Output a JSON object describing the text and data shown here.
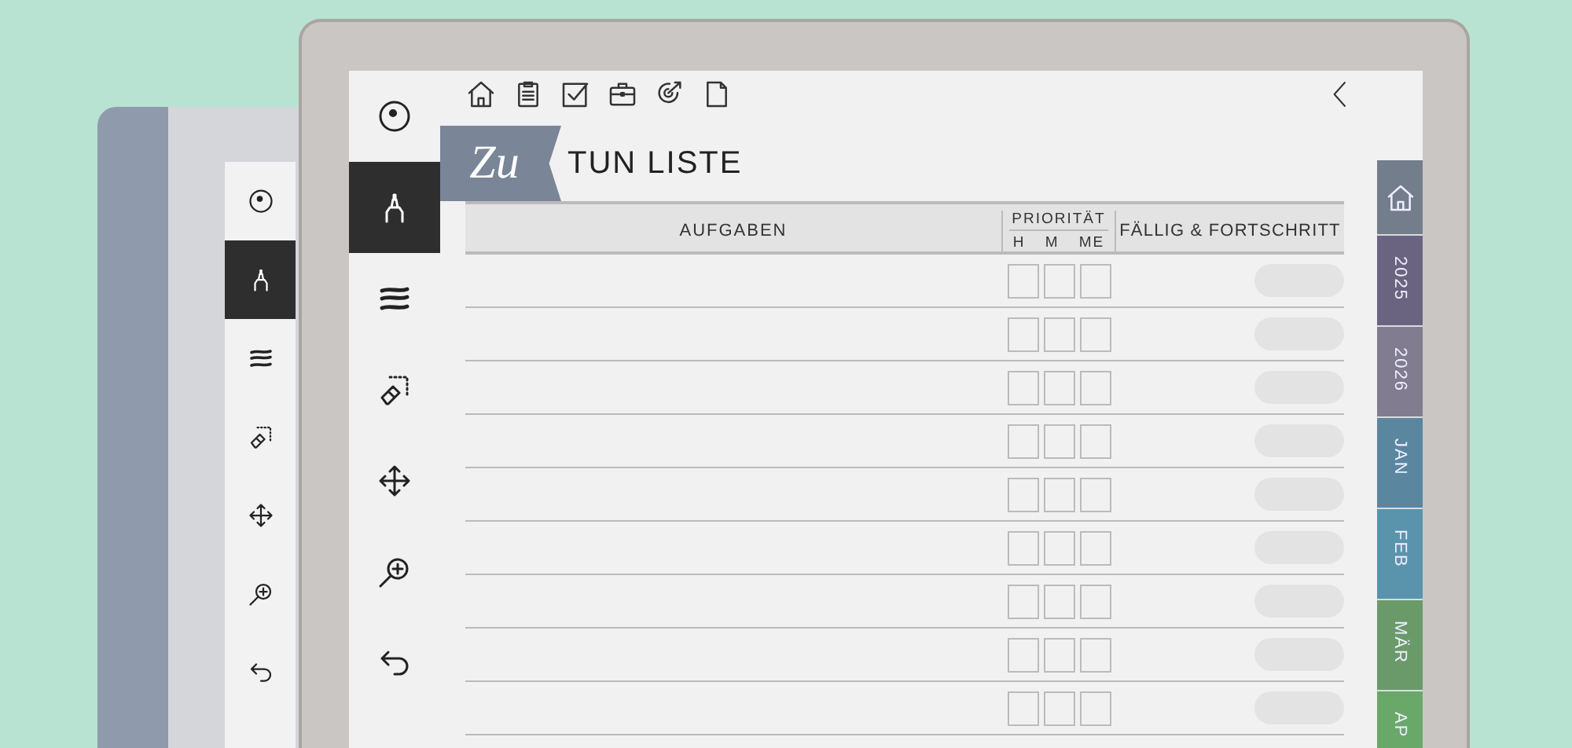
{
  "back_device": {
    "toolbar": [
      {
        "selected": false
      },
      {
        "selected": true
      },
      {
        "selected": false
      },
      {
        "selected": false
      },
      {
        "selected": false
      },
      {
        "selected": false
      },
      {
        "selected": false
      }
    ]
  },
  "front_device": {
    "toolbar": [
      {
        "selected": false
      },
      {
        "selected": true
      },
      {
        "selected": false
      },
      {
        "selected": false
      },
      {
        "selected": false
      },
      {
        "selected": false
      },
      {
        "selected": false
      }
    ],
    "title": {
      "script": "Zu",
      "text": "TUN LISTE"
    },
    "table": {
      "header": {
        "task": "AUFGABEN",
        "priority": {
          "label": "PRIORITÄT",
          "levels": [
            "H",
            "M",
            "ME"
          ]
        },
        "due": "FÄLLIG & FORTSCHRITT"
      },
      "rows": [
        {
          "priority": [
            {
              "checked": false
            },
            {
              "checked": false
            },
            {
              "checked": false
            }
          ]
        },
        {
          "priority": [
            {
              "checked": false
            },
            {
              "checked": false
            },
            {
              "checked": false
            }
          ]
        },
        {
          "priority": [
            {
              "checked": false
            },
            {
              "checked": false
            },
            {
              "checked": false
            }
          ]
        },
        {
          "priority": [
            {
              "checked": false
            },
            {
              "checked": false
            },
            {
              "checked": false
            }
          ]
        },
        {
          "priority": [
            {
              "checked": false
            },
            {
              "checked": false
            },
            {
              "checked": false
            }
          ]
        },
        {
          "priority": [
            {
              "checked": false
            },
            {
              "checked": false
            },
            {
              "checked": false
            }
          ]
        },
        {
          "priority": [
            {
              "checked": false
            },
            {
              "checked": false
            },
            {
              "checked": false
            }
          ]
        },
        {
          "priority": [
            {
              "checked": false
            },
            {
              "checked": false
            },
            {
              "checked": false
            }
          ]
        },
        {
          "priority": [
            {
              "checked": false
            },
            {
              "checked": false
            },
            {
              "checked": false
            }
          ]
        }
      ]
    },
    "side_tabs": [
      {
        "kind": "home",
        "color": "#737d8c"
      },
      {
        "kind": "text",
        "label": "2025",
        "color": "#6b6480"
      },
      {
        "kind": "text",
        "label": "2026",
        "color": "#817c90"
      },
      {
        "kind": "text",
        "label": "JAN",
        "color": "#5a86a0"
      },
      {
        "kind": "text",
        "label": "FEB",
        "color": "#5a94ac"
      },
      {
        "kind": "text",
        "label": "MÄR",
        "color": "#6a9a6a"
      },
      {
        "kind": "text",
        "label": "AP",
        "color": "#6aa86a"
      }
    ]
  }
}
